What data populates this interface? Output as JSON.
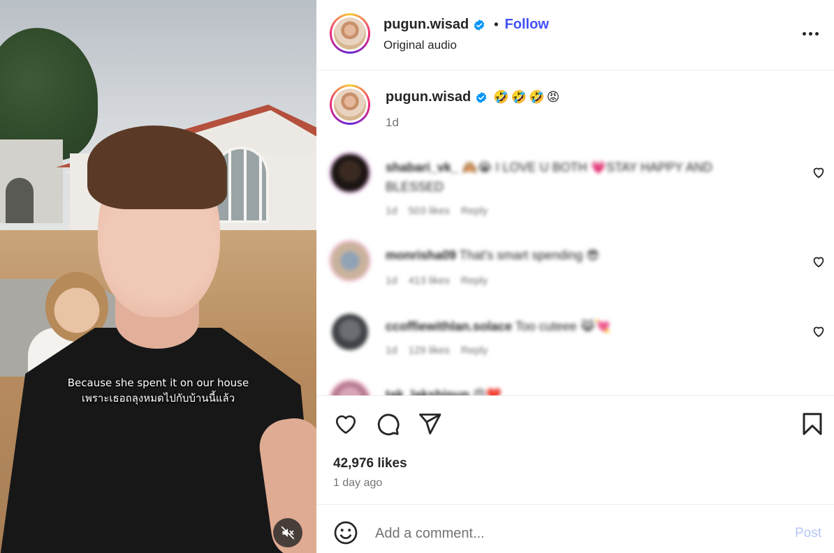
{
  "video": {
    "subtitle_en": "Because she spent it on our house",
    "subtitle_th": "เพราะเธอถลุงหมดไปกับบ้านนี้แล้ว",
    "mute_icon": "speaker-muted-icon"
  },
  "header": {
    "username": "pugun.wisad",
    "verified_icon": "verified-badge-icon",
    "separator": "•",
    "follow_label": "Follow",
    "audio_label": "Original audio",
    "more_icon": "more-options-icon"
  },
  "caption": {
    "username": "pugun.wisad",
    "text": "🤣🤣🤣😡",
    "time": "1d"
  },
  "comments": [
    {
      "username": "shabari_vk_",
      "text": "🙈😭 I LOVE U BOTH 💗STAY HAPPY AND BLESSED",
      "time": "1d",
      "likes": "503 likes",
      "reply": "Reply"
    },
    {
      "username": "monrisha09",
      "text": "That's smart spending 😎",
      "time": "1d",
      "likes": "413 likes",
      "reply": "Reply"
    },
    {
      "username": "ccoffiewithlan.solace",
      "text": "Too cuteee 😹💘",
      "time": "1d",
      "likes": "129 likes",
      "reply": "Reply"
    },
    {
      "username": "tak_lakshinun",
      "text": "😍❤️",
      "time": "",
      "likes": "",
      "reply": ""
    }
  ],
  "actions": {
    "like_icon": "heart-icon",
    "comment_icon": "comment-icon",
    "share_icon": "share-icon",
    "save_icon": "bookmark-icon",
    "likes_count": "42,976 likes",
    "posted_ago": "1 day ago"
  },
  "composer": {
    "emoji_icon": "emoji-icon",
    "placeholder": "Add a comment...",
    "post_label": "Post"
  },
  "colors": {
    "follow": "#4150f7",
    "post_disabled": "#b3c7f7",
    "verified": "#0095f6",
    "muted_text": "#737373"
  }
}
